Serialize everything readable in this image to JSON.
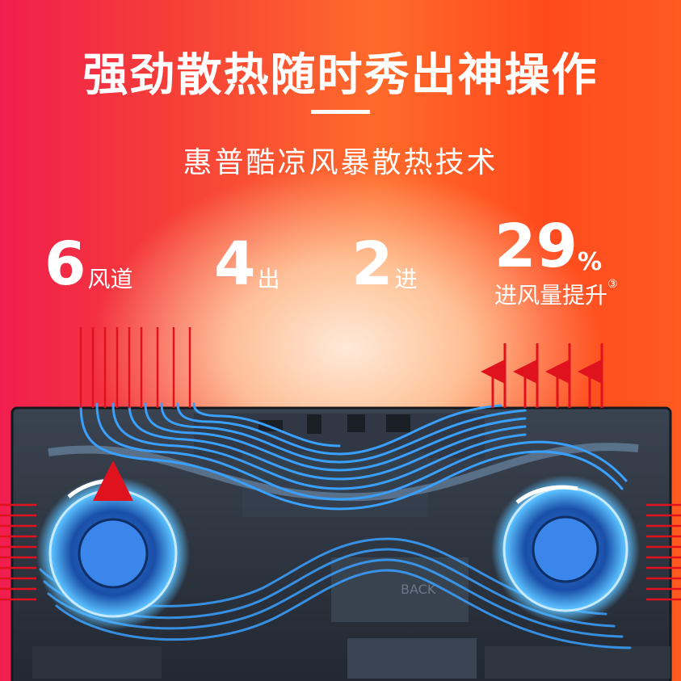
{
  "headline": "强劲散热随时秀出神操作",
  "subtitle": "惠普酷凉风暴散热技术",
  "stats": [
    {
      "number": "6",
      "unit": "风道"
    },
    {
      "number": "4",
      "unit": "出"
    },
    {
      "number": "2",
      "unit": "进"
    },
    {
      "number": "29",
      "unit": "%",
      "caption": "进风量提升",
      "footnote": "③"
    }
  ],
  "board_label": "BACK",
  "colors": {
    "background_left": "#f01e4e",
    "background_right": "#ff5a20",
    "chassis": "#2c3440",
    "airflow_blue": "#3aa0ff",
    "fan_glow": "#4fb4ff",
    "arrow_red": "#e0121e",
    "text": "#ffffff"
  }
}
